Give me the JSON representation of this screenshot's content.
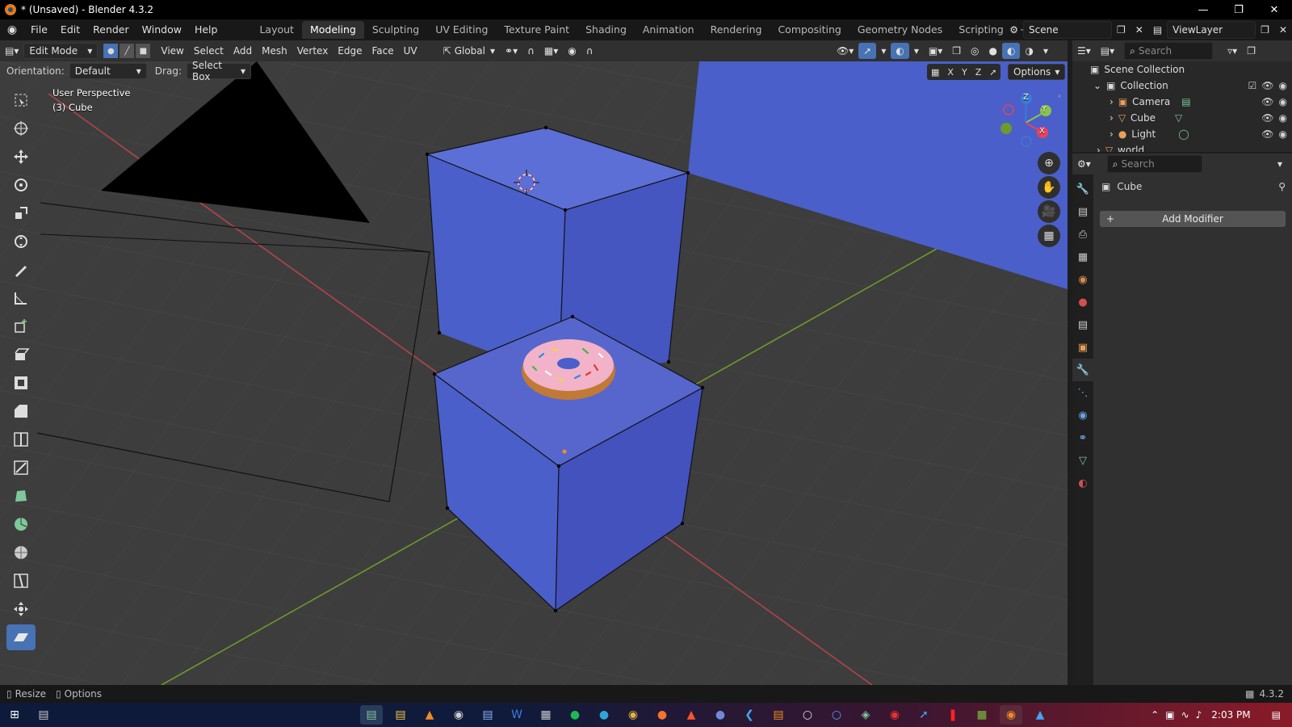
{
  "window": {
    "title": "* (Unsaved) - Blender 4.3.2",
    "controls": [
      "minimize",
      "restore",
      "close"
    ]
  },
  "menu": [
    "File",
    "Edit",
    "Render",
    "Window",
    "Help"
  ],
  "workspaces": [
    "Layout",
    "Modeling",
    "Sculpting",
    "UV Editing",
    "Texture Paint",
    "Shading",
    "Animation",
    "Rendering",
    "Compositing",
    "Geometry Nodes",
    "Scripting"
  ],
  "active_workspace": "Modeling",
  "scene_name": "Scene",
  "view_layer": "ViewLayer",
  "viewport_header": {
    "mode": "Edit Mode",
    "menus": [
      "View",
      "Select",
      "Add",
      "Mesh",
      "Vertex",
      "Edge",
      "Face",
      "UV"
    ],
    "transform_orientation": "Global"
  },
  "tool_settings": {
    "orientation_label": "Orientation:",
    "orientation_value": "Default",
    "drag_label": "Drag:",
    "drag_value": "Select Box"
  },
  "viewport": {
    "perspective": "User Perspective",
    "object_info": "(3) Cube",
    "options_label": "Options",
    "axis_x": "X",
    "axis_y": "Y",
    "axis_z": "Z"
  },
  "gizmo": {
    "x": "X",
    "y": "Y",
    "z": "Z",
    "x_color": "#e8435a",
    "y_color": "#8bc34a",
    "z_color": "#3a7bd5"
  },
  "outliner": {
    "search_placeholder": "Search",
    "items": [
      {
        "label": "Scene Collection"
      },
      {
        "label": "Collection"
      },
      {
        "label": "Camera"
      },
      {
        "label": "Cube"
      },
      {
        "label": "Light"
      },
      {
        "label": "world"
      }
    ]
  },
  "properties": {
    "search_placeholder": "Search",
    "object_name": "Cube",
    "add_modifier": "Add Modifier"
  },
  "statusbar": {
    "left_1": "Resize",
    "left_2": "Options",
    "version": "4.3.2"
  },
  "taskbar": {
    "time": "2:03 PM"
  },
  "colors": {
    "accent": "#4772b3",
    "cube_face": "#4a5fc9",
    "viewport_bg": "#3d3d3d"
  }
}
